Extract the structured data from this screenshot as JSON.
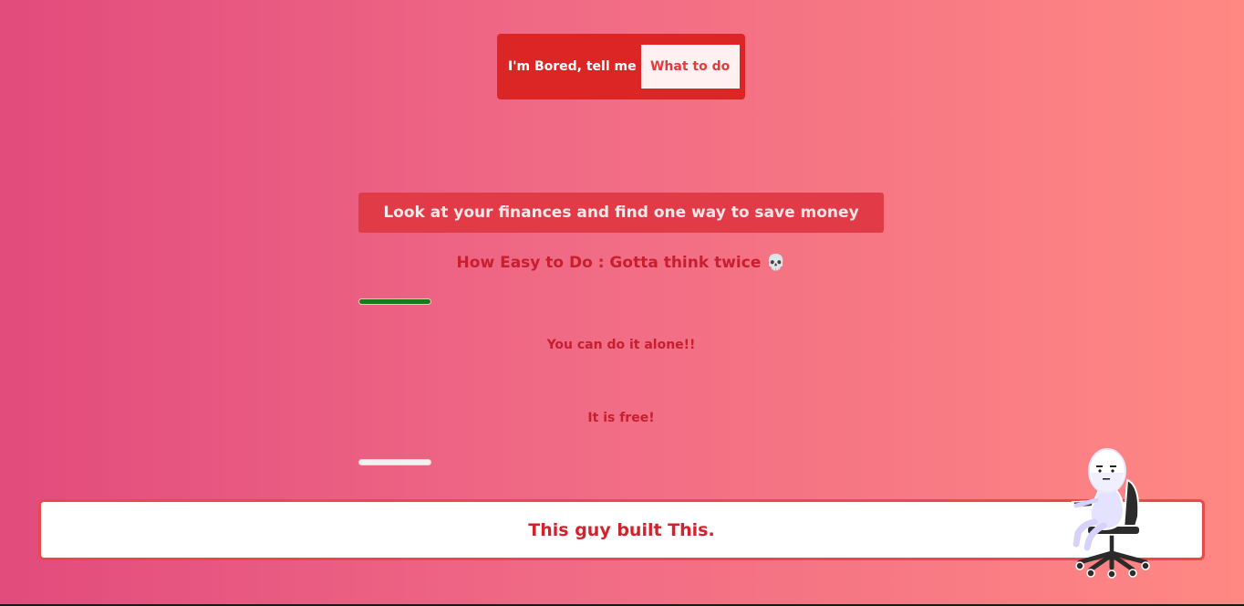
{
  "header": {
    "prompt_label": "I'm Bored, tell me",
    "action_button_label": "What to do"
  },
  "activity": {
    "text": "Look at your finances and find one way to save money",
    "ease_label": "How Easy to Do : Gotta think twice",
    "ease_emoji": "💀",
    "participants_text": "You can do it alone!!",
    "price_text": "It is free!"
  },
  "footer": {
    "text": "This guy built This."
  },
  "colors": {
    "accent": "#dc2626",
    "ease_bar": "#1a7a1a",
    "price_bar": "#f1f1f1"
  }
}
